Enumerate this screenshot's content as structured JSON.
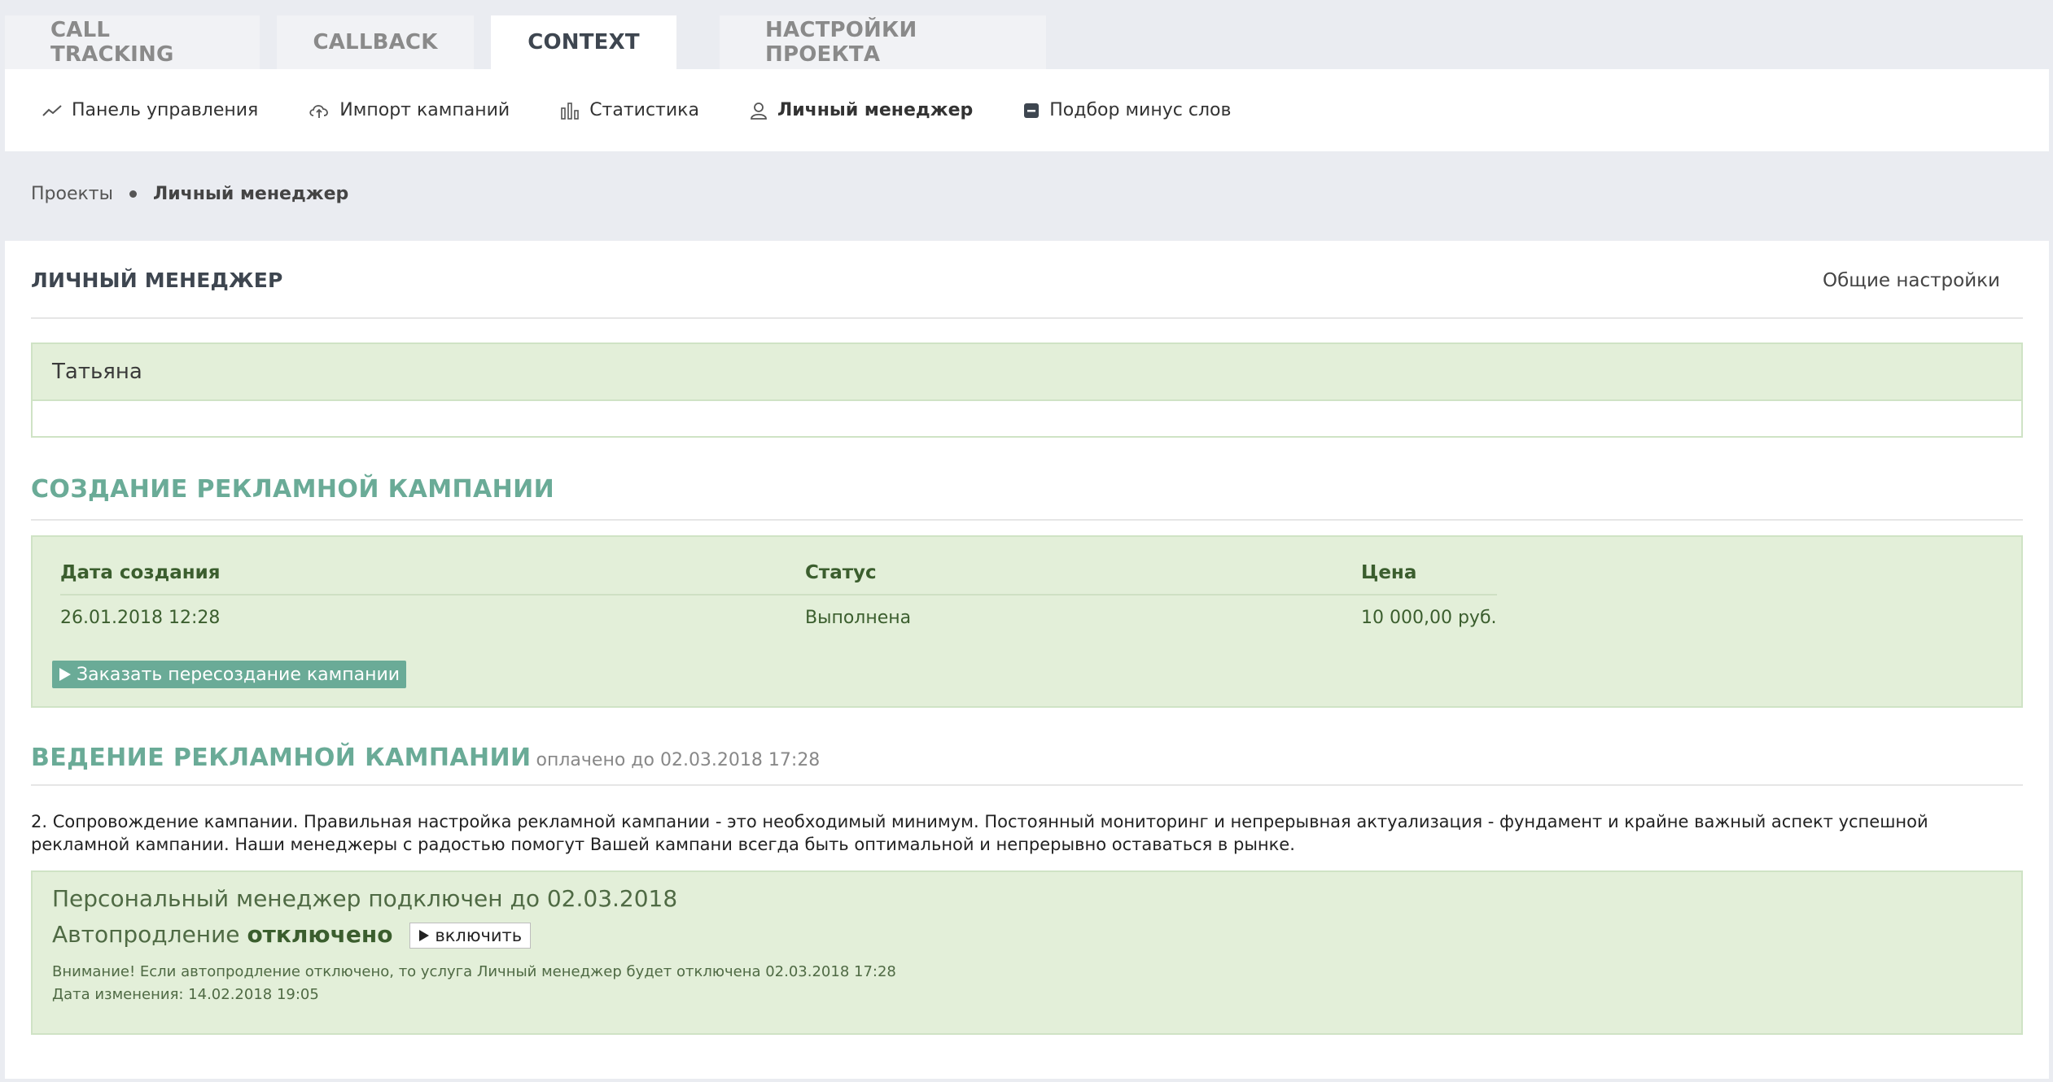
{
  "tabs": [
    "CALL TRACKING",
    "CALLBACK",
    "CONTEXT",
    "НАСТРОЙКИ ПРОЕКТА"
  ],
  "active_tab": "CONTEXT",
  "subnav": {
    "dashboard": "Панель управления",
    "import": "Импорт кампаний",
    "stats": "Статистика",
    "manager": "Личный менеджер",
    "minus_words": "Подбор минус слов"
  },
  "breadcrumb": {
    "root": "Проекты",
    "current": "Личный менеджер"
  },
  "panel": {
    "title": "ЛИЧНЫЙ МЕНЕДЖЕР",
    "settings_link": "Общие настройки"
  },
  "manager_name": "Татьяна",
  "creation": {
    "title": "СОЗДАНИЕ РЕКЛАМНОЙ КАМПАНИИ",
    "headers": {
      "date": "Дата создания",
      "status": "Статус",
      "price": "Цена"
    },
    "row": {
      "date": "26.01.2018 12:28",
      "status": "Выполнена",
      "price": "10 000,00 руб."
    },
    "button": "Заказать пересоздание кампании"
  },
  "management": {
    "title": "ВЕДЕНИЕ РЕКЛАМНОЙ КАМПАНИИ",
    "subtitle": "оплачено до 02.03.2018 17:28",
    "description": "2. Сопровождение кампании. Правильная настройка рекламной кампании - это необходимый минимум. Постоянный мониторинг и непрерывная актуализация - фундамент и крайне важный аспект успешной рекламной кампании. Наши менеджеры с радостью помогут Вашей кампани всегда быть оптимальной и непрерывно оставаться в рынке.",
    "connected": "Персональный менеджер подключен до 02.03.2018",
    "autorenew_label": "Автопродление",
    "autorenew_state": "отключено",
    "enable_button": "включить",
    "warning": "Внимание! Если автопродление отключено, то услуга Личный менеджер будет отключена 02.03.2018 17:28",
    "changed": "Дата изменения: 14.02.2018 19:05"
  },
  "colors": {
    "accent": "#6aab97",
    "green_bg": "#e3efd9",
    "green_text": "#3b5e2e",
    "page_bg": "#eaecf1"
  }
}
